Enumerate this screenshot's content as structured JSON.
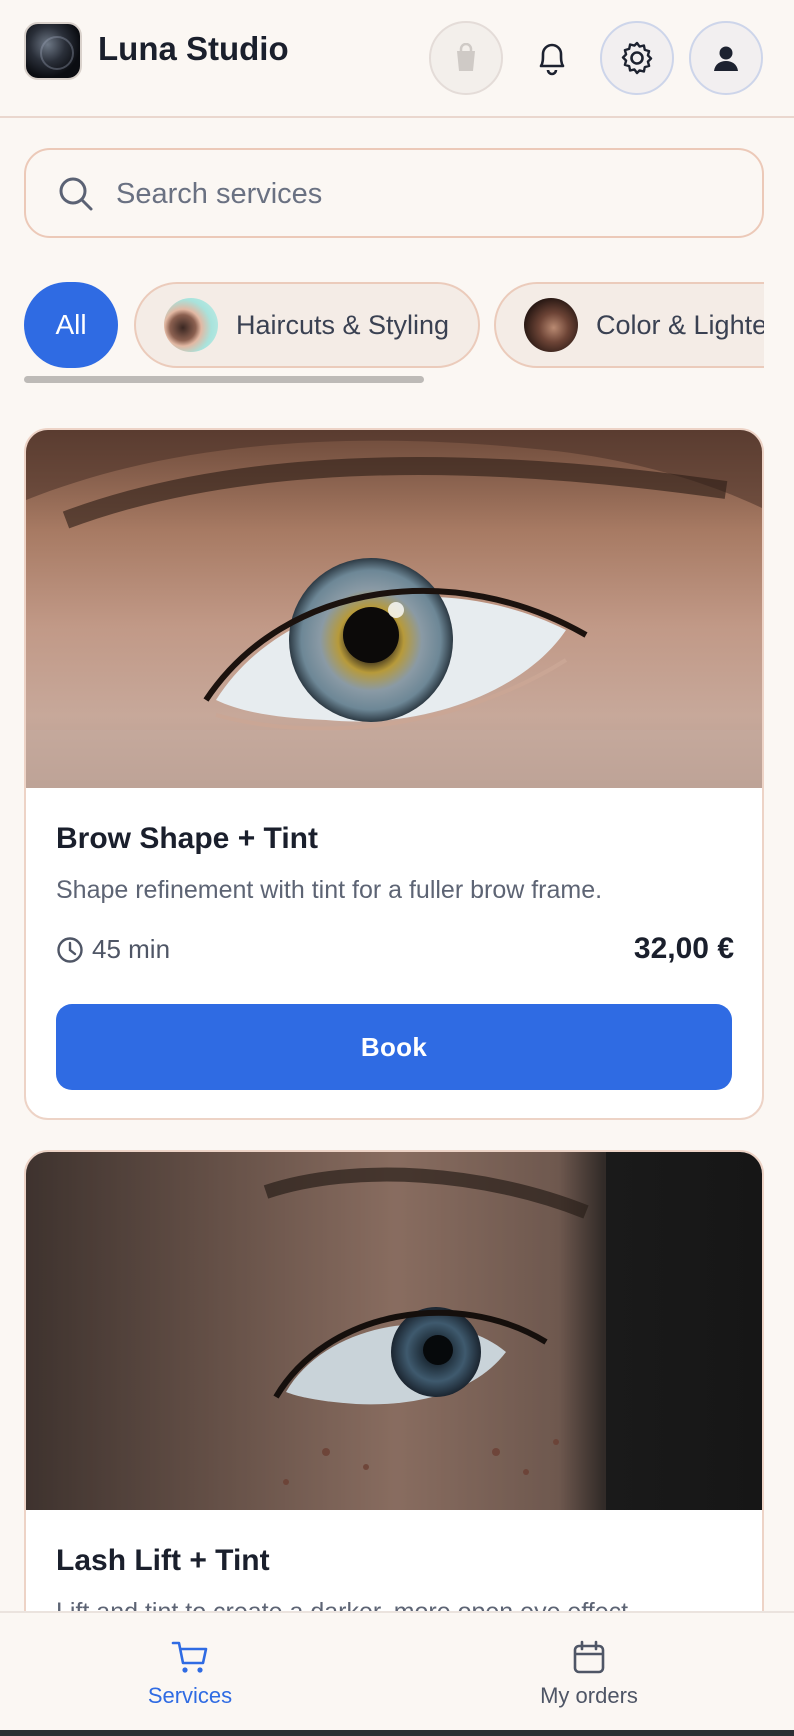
{
  "header": {
    "brand": "Luna Studio",
    "icons": [
      "bag-icon",
      "bell-icon",
      "gear-icon",
      "user-icon"
    ]
  },
  "search": {
    "placeholder": "Search services"
  },
  "categories": [
    {
      "label": "All",
      "selected": true
    },
    {
      "label": "Haircuts & Styling",
      "selected": false
    },
    {
      "label": "Color & Lighte",
      "selected": false
    }
  ],
  "services": [
    {
      "title": "Brow Shape + Tint",
      "description": "Shape refinement with tint for a fuller brow frame.",
      "duration": "45 min",
      "price": "32,00 €",
      "action": "Book"
    },
    {
      "title": "Lash Lift + Tint",
      "description": "Lift and tint to create a darker, more open eye effect."
    }
  ],
  "nav": {
    "services": "Services",
    "orders": "My orders"
  },
  "colors": {
    "accent": "#2f6be3",
    "background": "#fbf7f3",
    "chip_border": "#ebcbbb"
  }
}
